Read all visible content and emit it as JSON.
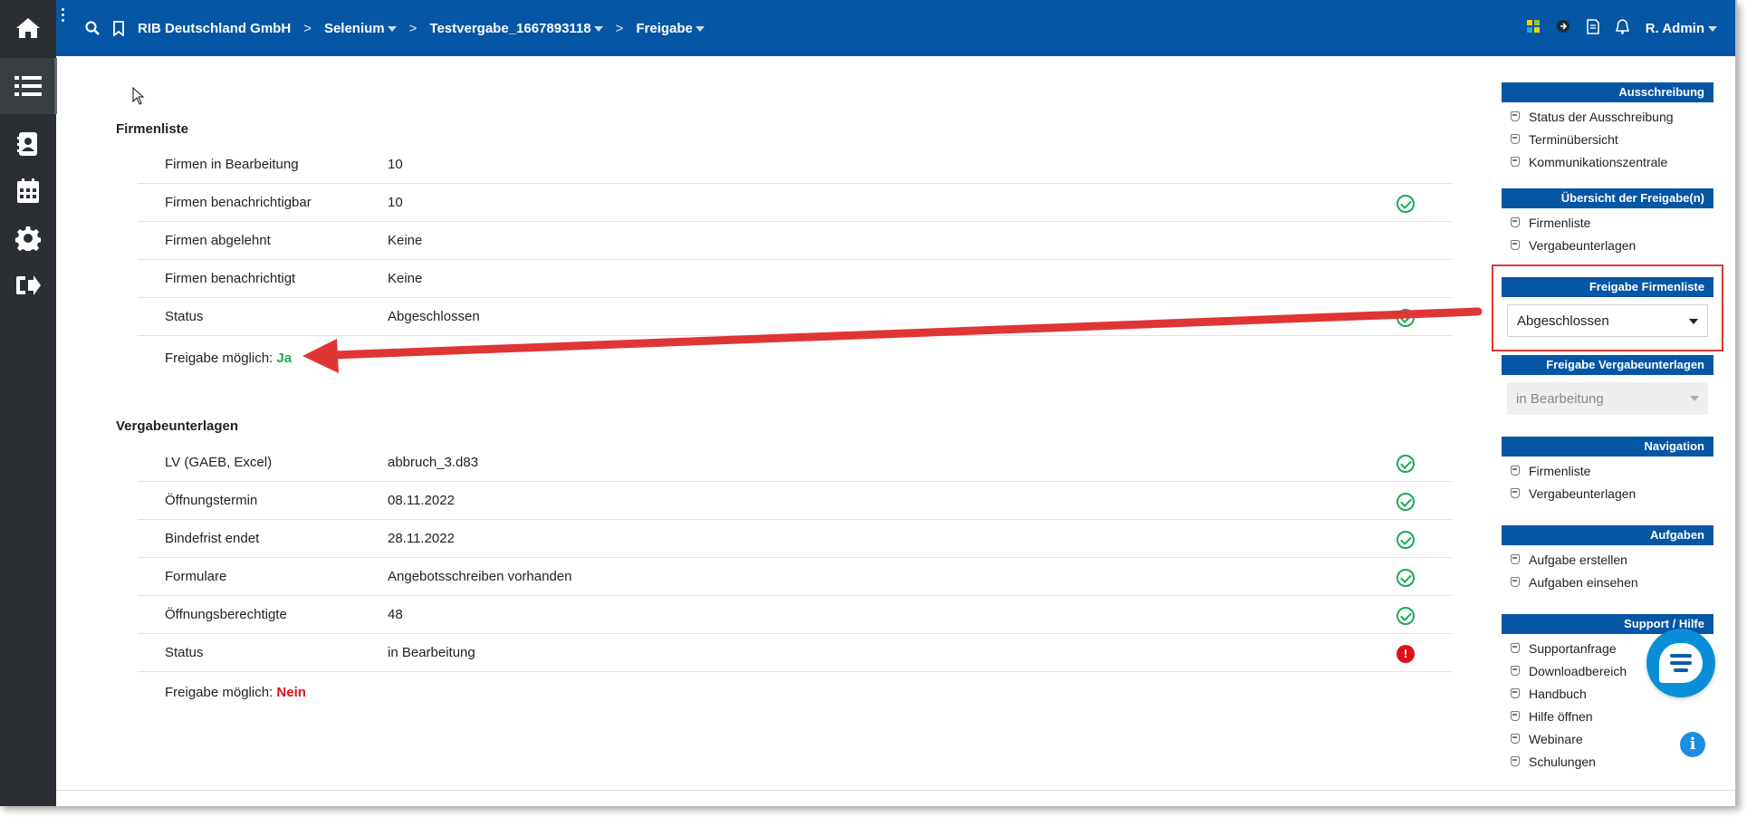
{
  "topbar": {
    "breadcrumbs": [
      {
        "label": "RIB Deutschland GmbH",
        "has_dropdown": false
      },
      {
        "label": "Selenium",
        "has_dropdown": true
      },
      {
        "label": "Testvergabe_1667893118",
        "has_dropdown": true
      },
      {
        "label": "Freigabe",
        "has_dropdown": true
      }
    ],
    "user": "R. Admin",
    "icons": [
      "search-icon",
      "bookmark-icon",
      "app-grid-icon",
      "arrow-circle-icon",
      "document-icon",
      "bell-icon"
    ]
  },
  "leftnav": {
    "items": [
      "home-icon",
      "list-icon",
      "contact-book-icon",
      "calendar-icon",
      "gear-icon",
      "logout-icon"
    ]
  },
  "firmenliste": {
    "title": "Firmenliste",
    "rows": [
      {
        "label": "Firmen in Bearbeitung",
        "value": "10",
        "status": ""
      },
      {
        "label": "Firmen benachrichtigbar",
        "value": "10",
        "status": "ok"
      },
      {
        "label": "Firmen abgelehnt",
        "value": "Keine",
        "status": ""
      },
      {
        "label": "Firmen benachrichtigt",
        "value": "Keine",
        "status": ""
      },
      {
        "label": "Status",
        "value": "Abgeschlossen",
        "status": "ok"
      }
    ],
    "freigabe_label": "Freigabe möglich:",
    "freigabe_value": "Ja"
  },
  "vergabeunterlagen": {
    "title": "Vergabeunterlagen",
    "rows": [
      {
        "label": "LV (GAEB, Excel)",
        "value": "abbruch_3.d83",
        "status": "ok"
      },
      {
        "label": "Öffnungstermin",
        "value": "08.11.2022",
        "status": "ok"
      },
      {
        "label": "Bindefrist endet",
        "value": "28.11.2022",
        "status": "ok"
      },
      {
        "label": "Formulare",
        "value": "Angebotsschreiben vorhanden",
        "status": "ok"
      },
      {
        "label": "Öffnungsberechtigte",
        "value": "48",
        "status": "ok"
      },
      {
        "label": "Status",
        "value": "in Bearbeitung",
        "status": "error"
      }
    ],
    "freigabe_label": "Freigabe möglich:",
    "freigabe_value": "Nein"
  },
  "sidebar": {
    "ausschreibung": {
      "title": "Ausschreibung",
      "items": [
        "Status der Ausschreibung",
        "Terminübersicht",
        "Kommunikationszentrale"
      ]
    },
    "uebersicht": {
      "title": "Übersicht der Freigabe(n)",
      "items": [
        "Firmenliste",
        "Vergabeunterlagen"
      ]
    },
    "freigabe_firmenliste": {
      "title": "Freigabe Firmenliste",
      "selected": "Abgeschlossen"
    },
    "freigabe_vergabeunterlagen": {
      "title": "Freigabe Vergabeunterlagen",
      "selected": "in Bearbeitung"
    },
    "navigation": {
      "title": "Navigation",
      "items": [
        "Firmenliste",
        "Vergabeunterlagen"
      ]
    },
    "aufgaben": {
      "title": "Aufgaben",
      "items": [
        "Aufgabe erstellen",
        "Aufgaben einsehen"
      ]
    },
    "support": {
      "title": "Support / Hilfe",
      "items": [
        "Supportanfrage",
        "Downloadbereich",
        "Handbuch",
        "Hilfe öffnen",
        "Webinare",
        "Schulungen"
      ]
    }
  },
  "colors": {
    "topbar": "#0556a4",
    "leftnav": "#2b2f33",
    "ok": "#1aaa55",
    "error": "#e0101a",
    "annotation": "#e03535"
  }
}
